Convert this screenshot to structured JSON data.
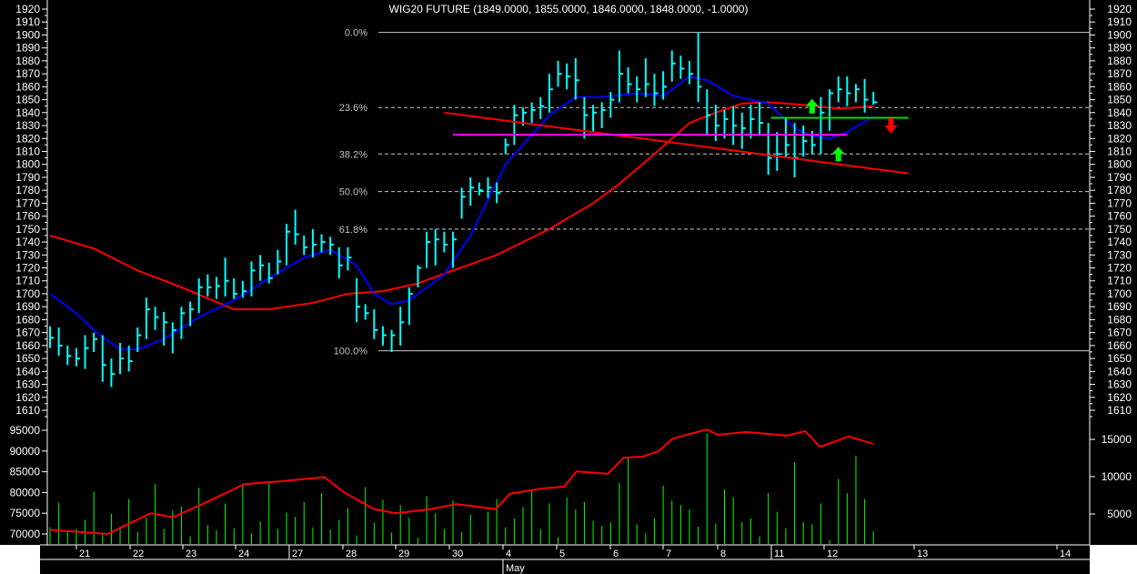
{
  "chart_data": {
    "type": "ohlc",
    "title": "WIG20 FUTURE (1849.0000, 1855.0000, 1846.0000, 1848.0000, -1.0000)",
    "price_axis": {
      "min": 1610,
      "max": 1920,
      "step": 10
    },
    "oi_axis": {
      "ticks": [
        95000,
        90000,
        85000,
        80000,
        75000,
        70000
      ]
    },
    "volume_axis": {
      "ticks": [
        15000,
        10000,
        5000
      ]
    },
    "ohlc_format": "[high, low, close]",
    "bars": [
      [
        1675,
        1658,
        1666
      ],
      [
        1674,
        1652,
        1660
      ],
      [
        1660,
        1645,
        1652
      ],
      [
        1658,
        1644,
        1650
      ],
      [
        1668,
        1642,
        1658
      ],
      [
        1670,
        1655,
        1665
      ],
      [
        1668,
        1632,
        1645
      ],
      [
        1650,
        1628,
        1638
      ],
      [
        1662,
        1638,
        1650
      ],
      [
        1660,
        1640,
        1648
      ],
      [
        1674,
        1655,
        1668
      ],
      [
        1697,
        1665,
        1688
      ],
      [
        1690,
        1672,
        1682
      ],
      [
        1686,
        1660,
        1678
      ],
      [
        1678,
        1654,
        1672
      ],
      [
        1690,
        1665,
        1685
      ],
      [
        1694,
        1675,
        1688
      ],
      [
        1712,
        1685,
        1705
      ],
      [
        1715,
        1698,
        1705
      ],
      [
        1713,
        1696,
        1706
      ],
      [
        1728,
        1698,
        1710
      ],
      [
        1712,
        1696,
        1700
      ],
      [
        1710,
        1697,
        1702
      ],
      [
        1725,
        1698,
        1718
      ],
      [
        1730,
        1710,
        1722
      ],
      [
        1724,
        1708,
        1712
      ],
      [
        1734,
        1715,
        1725
      ],
      [
        1754,
        1722,
        1748
      ],
      [
        1765,
        1738,
        1746
      ],
      [
        1745,
        1730,
        1736
      ],
      [
        1750,
        1728,
        1738
      ],
      [
        1746,
        1732,
        1740
      ],
      [
        1744,
        1730,
        1738
      ],
      [
        1736,
        1712,
        1722
      ],
      [
        1736,
        1718,
        1728
      ],
      [
        1712,
        1678,
        1690
      ],
      [
        1692,
        1680,
        1685
      ],
      [
        1688,
        1665,
        1672
      ],
      [
        1675,
        1660,
        1668
      ],
      [
        1672,
        1655,
        1668
      ],
      [
        1690,
        1660,
        1678
      ],
      [
        1705,
        1676,
        1700
      ],
      [
        1722,
        1705,
        1720
      ],
      [
        1748,
        1720,
        1740
      ],
      [
        1750,
        1722,
        1742
      ],
      [
        1748,
        1732,
        1738
      ],
      [
        1748,
        1720,
        1742
      ],
      [
        1782,
        1758,
        1775
      ],
      [
        1790,
        1768,
        1782
      ],
      [
        1786,
        1776,
        1780
      ],
      [
        1790,
        1774,
        1782
      ],
      [
        1786,
        1770,
        1778
      ],
      [
        1820,
        1808,
        1815
      ],
      [
        1846,
        1815,
        1838
      ],
      [
        1844,
        1830,
        1840
      ],
      [
        1848,
        1832,
        1842
      ],
      [
        1852,
        1835,
        1845
      ],
      [
        1870,
        1840,
        1858
      ],
      [
        1880,
        1860,
        1870
      ],
      [
        1878,
        1858,
        1868
      ],
      [
        1882,
        1850,
        1865
      ],
      [
        1852,
        1820,
        1838
      ],
      [
        1846,
        1825,
        1840
      ],
      [
        1848,
        1828,
        1842
      ],
      [
        1856,
        1836,
        1850
      ],
      [
        1888,
        1848,
        1870
      ],
      [
        1875,
        1855,
        1862
      ],
      [
        1868,
        1848,
        1858
      ],
      [
        1882,
        1852,
        1862
      ],
      [
        1870,
        1845,
        1855
      ],
      [
        1872,
        1850,
        1860
      ],
      [
        1888,
        1864,
        1878
      ],
      [
        1884,
        1866,
        1874
      ],
      [
        1880,
        1862,
        1870
      ],
      [
        1902,
        1848,
        1860
      ],
      [
        1858,
        1822,
        1838
      ],
      [
        1846,
        1818,
        1830
      ],
      [
        1842,
        1820,
        1835
      ],
      [
        1845,
        1815,
        1830
      ],
      [
        1840,
        1812,
        1828
      ],
      [
        1846,
        1820,
        1835
      ],
      [
        1848,
        1822,
        1832
      ],
      [
        1832,
        1792,
        1805
      ],
      [
        1825,
        1795,
        1808
      ],
      [
        1836,
        1805,
        1815
      ],
      [
        1832,
        1790,
        1805
      ],
      [
        1830,
        1806,
        1818
      ],
      [
        1826,
        1808,
        1815
      ],
      [
        1852,
        1808,
        1840
      ],
      [
        1858,
        1826,
        1855
      ],
      [
        1868,
        1848,
        1858
      ],
      [
        1868,
        1845,
        1855
      ],
      [
        1862,
        1848,
        1858
      ],
      [
        1866,
        1840,
        1850
      ],
      [
        1856,
        1846,
        1848
      ]
    ],
    "moving_average_short": {
      "color": "#0000ff",
      "points": [
        [
          0,
          1700
        ],
        [
          3,
          1685
        ],
        [
          5,
          1672
        ],
        [
          8,
          1657
        ],
        [
          10,
          1657
        ],
        [
          13,
          1665
        ],
        [
          17,
          1682
        ],
        [
          21,
          1695
        ],
        [
          25,
          1712
        ],
        [
          29,
          1728
        ],
        [
          32,
          1734
        ],
        [
          35,
          1722
        ],
        [
          37,
          1700
        ],
        [
          39,
          1692
        ],
        [
          41,
          1695
        ],
        [
          45,
          1715
        ],
        [
          48,
          1745
        ],
        [
          52,
          1800
        ],
        [
          57,
          1838
        ],
        [
          60,
          1852
        ],
        [
          63,
          1852
        ],
        [
          67,
          1855
        ],
        [
          70,
          1853
        ],
        [
          73,
          1868
        ],
        [
          75,
          1865
        ],
        [
          78,
          1853
        ],
        [
          82,
          1847
        ],
        [
          85,
          1828
        ],
        [
          87,
          1822
        ],
        [
          89,
          1820
        ],
        [
          91,
          1825
        ],
        [
          94,
          1837
        ]
      ]
    },
    "moving_average_long": {
      "color": "#ff0000",
      "points": [
        [
          0,
          1745
        ],
        [
          5,
          1735
        ],
        [
          10,
          1718
        ],
        [
          15,
          1705
        ],
        [
          21,
          1688
        ],
        [
          25,
          1688
        ],
        [
          30,
          1693
        ],
        [
          34,
          1700
        ],
        [
          38,
          1702
        ],
        [
          42,
          1708
        ],
        [
          46,
          1718
        ],
        [
          51,
          1730
        ],
        [
          57,
          1750
        ],
        [
          62,
          1770
        ],
        [
          65,
          1785
        ],
        [
          69,
          1808
        ],
        [
          73,
          1832
        ],
        [
          76,
          1840
        ],
        [
          79,
          1847
        ],
        [
          82,
          1848
        ],
        [
          86,
          1846
        ],
        [
          90,
          1843
        ],
        [
          94,
          1845
        ]
      ]
    },
    "fibonacci": {
      "high": 1902,
      "low": 1656,
      "levels": [
        {
          "label": "0.0%",
          "ratio": 0
        },
        {
          "label": "23.6%",
          "ratio": 0.236
        },
        {
          "label": "38.2%",
          "ratio": 0.382
        },
        {
          "label": "50.0%",
          "ratio": 0.5
        },
        {
          "label": "61.8%",
          "ratio": 0.618
        },
        {
          "label": "100.0%",
          "ratio": 1
        }
      ]
    },
    "trendlines": [
      {
        "name": "descending-trendline",
        "color": "#ff0000",
        "from": [
          45,
          1840
        ],
        "to": [
          98,
          1793
        ]
      },
      {
        "name": "support-line",
        "color": "#ff00ff",
        "from": [
          46,
          1823
        ],
        "to": [
          91,
          1823
        ]
      },
      {
        "name": "resistance-line",
        "color": "#00dd00",
        "from": [
          82.3,
          1836
        ],
        "to": [
          98,
          1836
        ]
      }
    ],
    "signals": [
      {
        "type": "buy",
        "bar": 87,
        "price": 1845
      },
      {
        "type": "buy",
        "bar": 90,
        "price": 1808
      },
      {
        "type": "sell",
        "bar": 96,
        "price": 1830
      }
    ],
    "volume": [
      3200,
      6500,
      2800,
      3000,
      4200,
      8000,
      2500,
      5000,
      3300,
      7000,
      2600,
      4500,
      9000,
      3000,
      5500,
      6000,
      2000,
      8500,
      3500,
      2800,
      6400,
      3100,
      8800,
      2400,
      4000,
      9200,
      3000,
      5200,
      4600,
      6600,
      3200,
      7800,
      2900,
      4200,
      5800,
      2100,
      8600,
      3800,
      6900,
      2500,
      6200,
      4500,
      1800,
      7400,
      5100,
      3000,
      6800,
      2600,
      4900,
      1200,
      5300,
      7000,
      3200,
      4400,
      5900,
      8200,
      3000,
      6400,
      1900,
      7200,
      5600,
      6600,
      4100,
      3400,
      3900,
      9200,
      12600,
      3600,
      2400,
      4400,
      8800,
      6800,
      6200,
      5600,
      3300,
      15800,
      3700,
      8300,
      7200,
      3900,
      4400,
      2000,
      7800,
      5300,
      3100,
      11900,
      3900,
      3600,
      6400,
      1500,
      9700,
      7800,
      12800,
      7000,
      2700
    ],
    "open_interest": [
      [
        0,
        71000
      ],
      [
        6.6,
        70000
      ],
      [
        11.5,
        75000
      ],
      [
        14,
        74000
      ],
      [
        17.2,
        77000
      ],
      [
        19.7,
        79500
      ],
      [
        22.2,
        82000
      ],
      [
        26.3,
        82700
      ],
      [
        31.3,
        83700
      ],
      [
        33.6,
        80000
      ],
      [
        37,
        76000
      ],
      [
        39.5,
        75000
      ],
      [
        43.5,
        76000
      ],
      [
        46.4,
        77200
      ],
      [
        50.9,
        76000
      ],
      [
        52.5,
        79700
      ],
      [
        56.3,
        81000
      ],
      [
        58.7,
        81400
      ],
      [
        60.1,
        85100
      ],
      [
        63.7,
        84500
      ],
      [
        65.5,
        88400
      ],
      [
        67.6,
        88600
      ],
      [
        69.5,
        90000
      ],
      [
        71.1,
        93000
      ],
      [
        75,
        95200
      ],
      [
        76.2,
        93900
      ],
      [
        79.5,
        94600
      ],
      [
        84.1,
        93700
      ],
      [
        86.2,
        94800
      ],
      [
        87.9,
        91000
      ],
      [
        91.2,
        93500
      ],
      [
        94,
        91700
      ]
    ],
    "x_axis": {
      "days": [
        {
          "label": "21",
          "bar": 3
        },
        {
          "label": "22",
          "bar": 9.1
        },
        {
          "label": "23",
          "bar": 15.2
        },
        {
          "label": "24",
          "bar": 21.2
        },
        {
          "label": "27",
          "bar": 27.3
        },
        {
          "label": "28",
          "bar": 33.4
        },
        {
          "label": "29",
          "bar": 39.5
        },
        {
          "label": "30",
          "bar": 45.6
        },
        {
          "label": "4",
          "bar": 51.7
        },
        {
          "label": "5",
          "bar": 57.8
        },
        {
          "label": "6",
          "bar": 64
        },
        {
          "label": "7",
          "bar": 70
        },
        {
          "label": "8",
          "bar": 76.2
        },
        {
          "label": "11",
          "bar": 82.3
        },
        {
          "label": "12",
          "bar": 88.4
        },
        {
          "label": "13",
          "bar": 98.6
        },
        {
          "label": "14",
          "bar": 115
        }
      ],
      "week_separators": [
        "27",
        "11"
      ],
      "month": {
        "label": "May",
        "bar": 51.7
      }
    },
    "colors": {
      "bars": "#00ffff",
      "volume": "#00ff00",
      "open_interest": "#ff0000",
      "axis": "#ffffff",
      "fib": "#c0c0c0"
    }
  }
}
